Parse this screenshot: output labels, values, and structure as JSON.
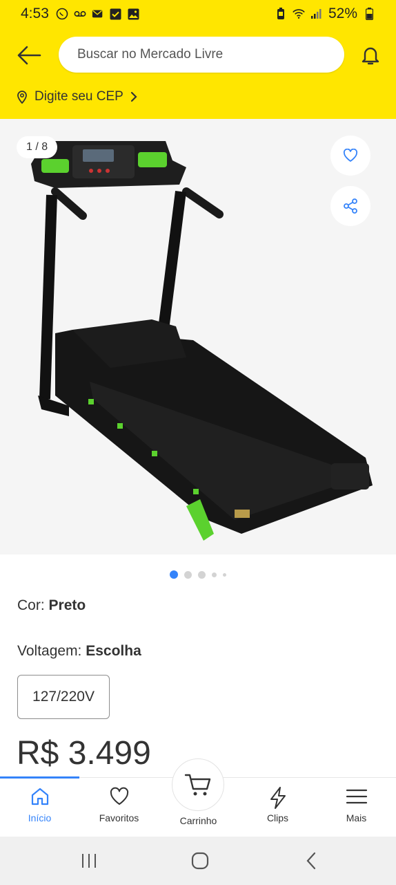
{
  "status_bar": {
    "time": "4:53",
    "battery": "52%"
  },
  "header": {
    "search_placeholder": "Buscar no Mercado Livre",
    "cep_label": "Digite seu CEP"
  },
  "gallery": {
    "counter": "1 / 8",
    "total_images": 8,
    "current_image": 1
  },
  "product": {
    "color_label": "Cor: ",
    "color_value": "Preto",
    "voltage_label": "Voltagem: ",
    "voltage_value": "Escolha",
    "voltage_option": "127/220V",
    "price": "R$ 3.499"
  },
  "bottom_nav": {
    "items": [
      {
        "label": "Início",
        "icon": "home-icon",
        "active": true
      },
      {
        "label": "Favoritos",
        "icon": "heart-icon",
        "active": false
      },
      {
        "label": "Carrinho",
        "icon": "cart-icon",
        "active": false
      },
      {
        "label": "Clips",
        "icon": "lightning-icon",
        "active": false
      },
      {
        "label": "Mais",
        "icon": "menu-icon",
        "active": false
      }
    ]
  },
  "colors": {
    "brand_yellow": "#ffe600",
    "accent_blue": "#3483fa",
    "text": "#333333"
  }
}
